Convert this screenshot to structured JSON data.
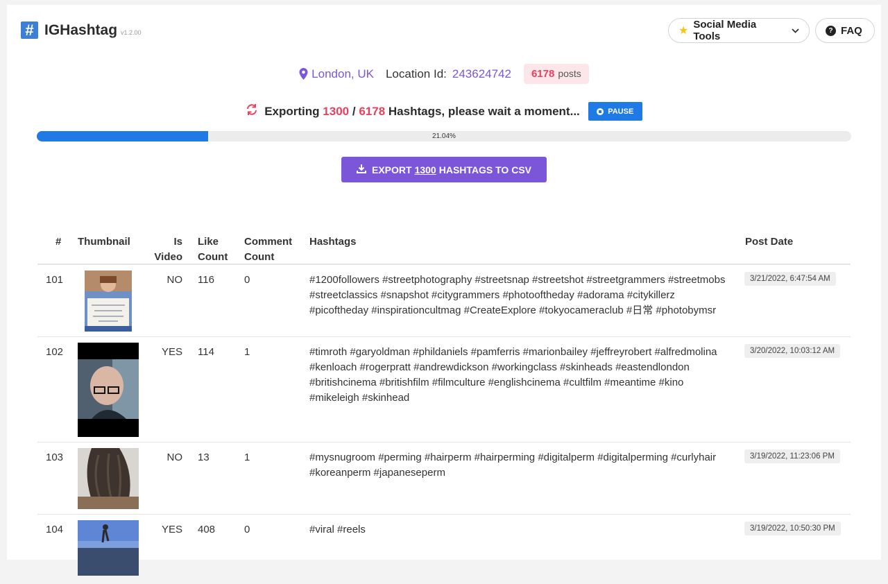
{
  "app": {
    "name": "IGHashtag",
    "version": "v1.2.00",
    "logo_glyph": "#"
  },
  "header": {
    "tools_label": "Social Media Tools",
    "faq_label": "FAQ"
  },
  "location": {
    "name": "London, UK",
    "id_label": "Location Id:",
    "id": "243624742",
    "posts_count": "6178",
    "posts_label": "posts"
  },
  "export_status": {
    "prefix": "Exporting",
    "current": "1300",
    "separator": "/",
    "total": "6178",
    "suffix": "Hashtags, please wait a moment...",
    "pause_label": "PAUSE"
  },
  "progress": {
    "percent": 21.04,
    "label": "21.04%"
  },
  "export_button": {
    "prefix": "EXPORT",
    "count": "1300",
    "suffix": "HASHTAGS TO CSV"
  },
  "table": {
    "headers": {
      "num": "#",
      "thumbnail": "Thumbnail",
      "is_video_1": "Is",
      "is_video_2": "Video",
      "like_1": "Like",
      "like_2": "Count",
      "comment_1": "Comment",
      "comment_2": "Count",
      "hashtags": "Hashtags",
      "post_date": "Post Date"
    },
    "rows": [
      {
        "num": "101",
        "is_video": "NO",
        "likes": "116",
        "comments": "0",
        "hashtags": "#1200followers #streetphotography #streetsnap #streetshot #streetgrammers #streetmobs #streetclassics #snapshot #citygrammers #photooftheday #adorama #citykillerz #picoftheday #inspirationcultmag #CreateExplore #tokyocameraclub #日常 #photobymsr",
        "date": "3/21/2022, 6:47:54 AM"
      },
      {
        "num": "102",
        "is_video": "YES",
        "likes": "114",
        "comments": "1",
        "hashtags": "#timroth #garyoldman #phildaniels #pamferris #marionbailey #jeffreyrobert #alfredmolina #kenloach #rogerpratt #andrewdickson #workingclass #skinheads #eastendlondon #britishcinema #britishfilm #filmculture #englishcinema #cultfilm #meantime #kino #mikeleigh #skinhead",
        "date": "3/20/2022, 10:03:12 AM"
      },
      {
        "num": "103",
        "is_video": "NO",
        "likes": "13",
        "comments": "1",
        "hashtags": "#mysnugroom #perming #hairperm #hairperming #digitalperm #digitalperming #curlyhair #koreanperm #japaneseperm",
        "date": "3/19/2022, 11:23:06 PM"
      },
      {
        "num": "104",
        "is_video": "YES",
        "likes": "408",
        "comments": "0",
        "hashtags": "#viral #reels",
        "date": "3/19/2022, 10:50:30 PM"
      }
    ]
  },
  "colors": {
    "accent_purple": "#7b56d8",
    "accent_red": "#e6415d",
    "accent_blue": "#1f7ae6"
  },
  "icons": {
    "location": "map-pin-icon",
    "sync": "sync-icon",
    "download": "download-icon",
    "star": "star-icon",
    "faq": "question-circle-icon"
  }
}
